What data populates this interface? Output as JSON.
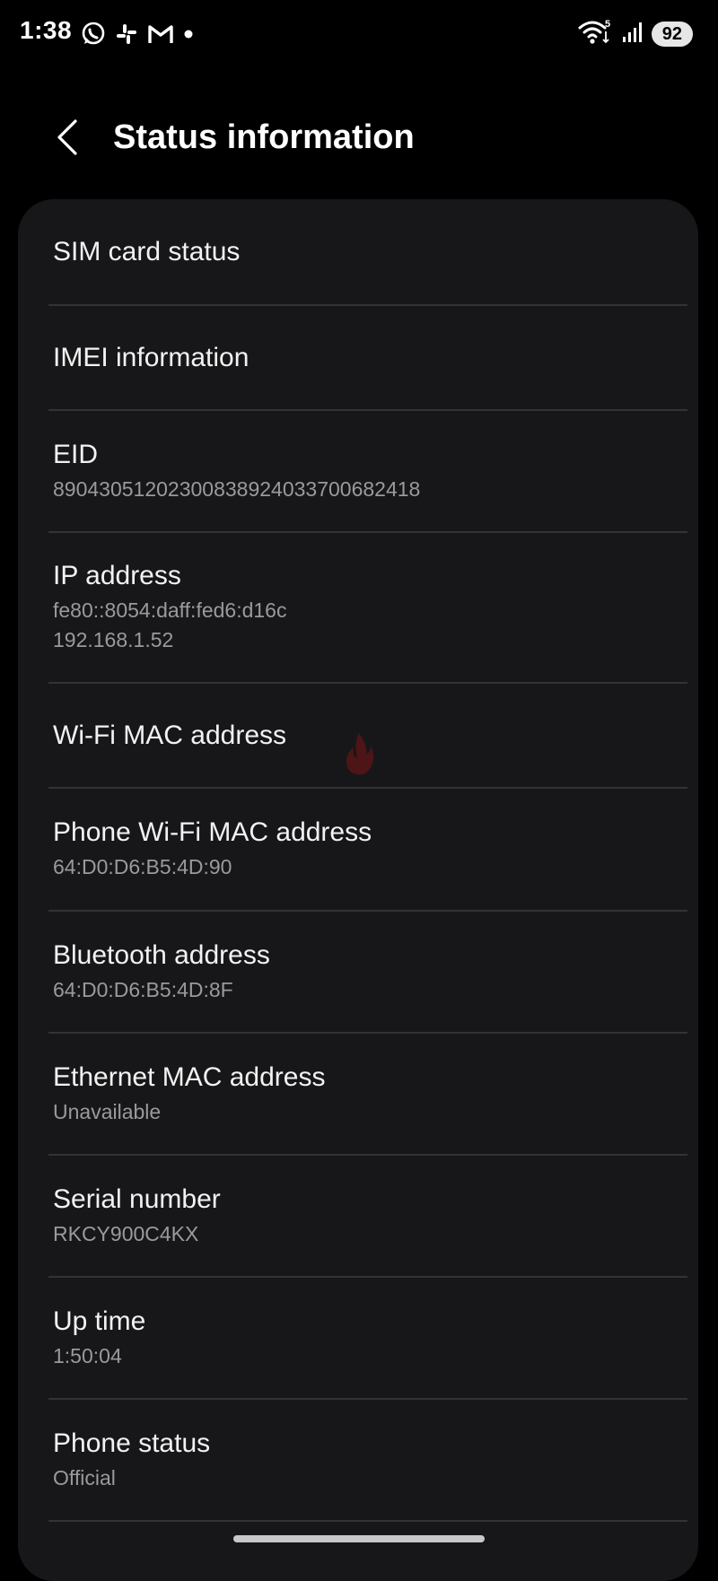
{
  "status_bar": {
    "time": "1:38",
    "notification_icons": [
      "whatsapp-icon",
      "slack-icon",
      "gmail-icon",
      "dot-icon"
    ],
    "wifi_label": "5",
    "battery": "92"
  },
  "header": {
    "title": "Status information"
  },
  "items": [
    {
      "title": "SIM card status"
    },
    {
      "title": "IMEI information"
    },
    {
      "title": "EID",
      "subtitle": "89043051202300838924033700682418"
    },
    {
      "title": "IP address",
      "subtitle": "fe80::8054:daff:fed6:d16c",
      "subtitle2": "192.168.1.52"
    },
    {
      "title": "Wi-Fi MAC address"
    },
    {
      "title": "Phone Wi-Fi MAC address",
      "subtitle": "64:D0:D6:B5:4D:90"
    },
    {
      "title": "Bluetooth address",
      "subtitle": "64:D0:D6:B5:4D:8F"
    },
    {
      "title": "Ethernet MAC address",
      "subtitle": "Unavailable"
    },
    {
      "title": "Serial number",
      "subtitle": "RKCY900C4KX"
    },
    {
      "title": "Up time",
      "subtitle": "1:50:04"
    },
    {
      "title": "Phone status",
      "subtitle": "Official"
    }
  ],
  "colors": {
    "background": "#000000",
    "card": "#171719",
    "title_text": "#f2f2f2",
    "subtitle_text": "#9a9a9e",
    "divider": "#333336"
  }
}
